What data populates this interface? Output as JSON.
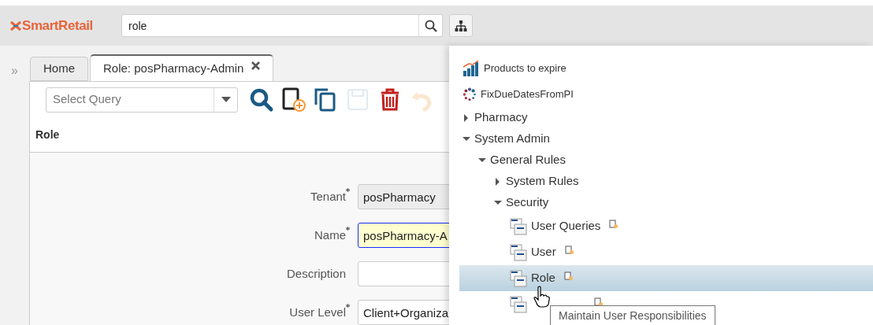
{
  "app": {
    "logo": "SmartRetail",
    "search": {
      "value": "role"
    }
  },
  "sidebar_toggle": "»",
  "tabs": [
    {
      "label": "Home",
      "selected": false,
      "closable": false
    },
    {
      "label": "Role: posPharmacy-Admin",
      "selected": true,
      "closable": true
    }
  ],
  "toolbar": {
    "query": {
      "placeholder": "Select Query"
    },
    "buttons": [
      {
        "kind": "search",
        "disabled": false
      },
      {
        "kind": "new",
        "disabled": false
      },
      {
        "kind": "copy",
        "disabled": false
      },
      {
        "kind": "save",
        "disabled": true
      },
      {
        "kind": "delete",
        "disabled": false
      },
      {
        "kind": "undo",
        "disabled": true
      }
    ]
  },
  "section": {
    "title": "Role"
  },
  "fields": [
    {
      "label": "Tenant",
      "required": true,
      "value": "posPharmacy",
      "readonly": true,
      "focused": false
    },
    {
      "label": "Name",
      "required": true,
      "value": "posPharmacy-A",
      "readonly": false,
      "focused": true
    },
    {
      "label": "Description",
      "required": false,
      "readonly": false,
      "focused": false
    },
    {
      "label": "User Level",
      "required": true,
      "value": "Client+Organiza",
      "readonly": false,
      "focused": false
    }
  ],
  "menu": {
    "items": [
      {
        "kind": "report",
        "label": "Products to expire"
      },
      {
        "kind": "process",
        "label": "FixDueDatesFromPI"
      },
      {
        "kind": "folder",
        "label": "Pharmacy",
        "expanded": false
      },
      {
        "kind": "folder",
        "label": "System Admin",
        "expanded": true,
        "children": [
          {
            "kind": "folder",
            "label": "General Rules",
            "expanded": true,
            "children": [
              {
                "kind": "folder",
                "label": "System Rules",
                "expanded": false
              },
              {
                "kind": "folder",
                "label": "Security",
                "expanded": true,
                "children": [
                  {
                    "kind": "window",
                    "label": "User Queries",
                    "selected": false
                  },
                  {
                    "kind": "window",
                    "label": "User",
                    "selected": false
                  },
                  {
                    "kind": "window",
                    "label": "Role",
                    "selected": true
                  },
                  {
                    "kind": "window",
                    "selected": false
                  }
                ]
              }
            ]
          }
        ]
      }
    ]
  },
  "tooltip": "Maintain User Responsibilities"
}
